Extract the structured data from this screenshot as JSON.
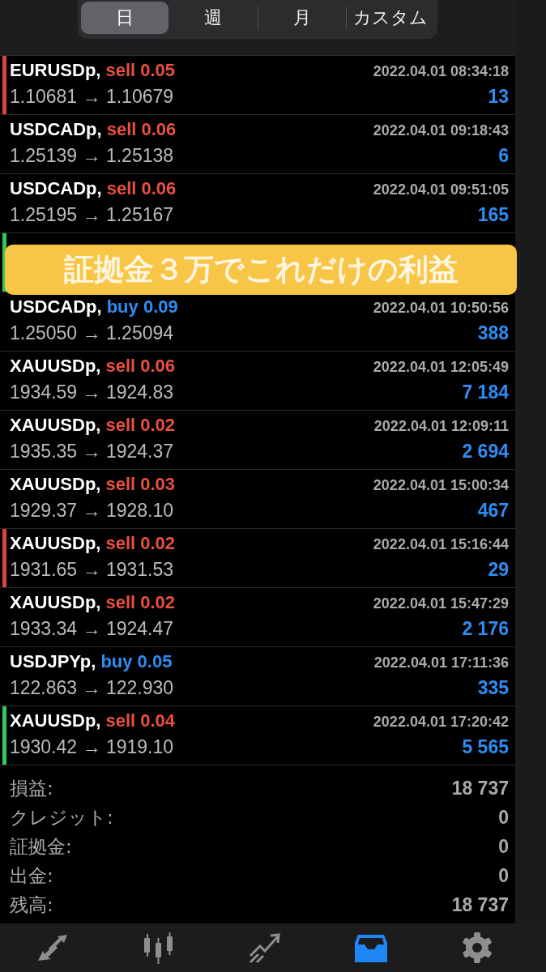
{
  "period_tabs": [
    {
      "label": "日",
      "selected": true
    },
    {
      "label": "週",
      "selected": false
    },
    {
      "label": "月",
      "selected": false
    },
    {
      "label": "カスタム",
      "selected": false
    }
  ],
  "deals": [
    {
      "symbol": "EURUSDp,",
      "kind": "sell",
      "order": "sell 0.05",
      "time": "2022.04.01 08:34:18",
      "prices": "1.10681 → 1.10679",
      "profit": "13",
      "color": "#d9453a"
    },
    {
      "symbol": "USDCADp,",
      "kind": "sell",
      "order": "sell 0.06",
      "time": "2022.04.01 09:18:43",
      "prices": "1.25139 → 1.25138",
      "profit": "6"
    },
    {
      "symbol": "USDCADp,",
      "kind": "sell",
      "order": "sell 0.06",
      "time": "2022.04.01 09:51:05",
      "prices": "1.25195 → 1.25167",
      "profit": "165"
    },
    {
      "kind": "hidden",
      "color": "#34c759"
    },
    {
      "symbol": "USDCADp,",
      "kind": "buy",
      "order": "buy 0.09",
      "time": "2022.04.01 10:50:56",
      "prices": "1.25050 → 1.25094",
      "profit": "388"
    },
    {
      "symbol": "XAUUSDp,",
      "kind": "sell",
      "order": "sell 0.06",
      "time": "2022.04.01 12:05:49",
      "prices": "1934.59 → 1924.83",
      "profit": "7 184"
    },
    {
      "symbol": "XAUUSDp,",
      "kind": "sell",
      "order": "sell 0.02",
      "time": "2022.04.01 12:09:11",
      "prices": "1935.35 → 1924.37",
      "profit": "2 694"
    },
    {
      "symbol": "XAUUSDp,",
      "kind": "sell",
      "order": "sell 0.03",
      "time": "2022.04.01 15:00:34",
      "prices": "1929.37 → 1928.10",
      "profit": "467"
    },
    {
      "symbol": "XAUUSDp,",
      "kind": "sell",
      "order": "sell 0.02",
      "time": "2022.04.01 15:16:44",
      "prices": "1931.65 → 1931.53",
      "profit": "29",
      "color": "#d9453a"
    },
    {
      "symbol": "XAUUSDp,",
      "kind": "sell",
      "order": "sell 0.02",
      "time": "2022.04.01 15:47:29",
      "prices": "1933.34 → 1924.47",
      "profit": "2 176"
    },
    {
      "symbol": "USDJPYp,",
      "kind": "buy",
      "order": "buy 0.05",
      "time": "2022.04.01 17:11:36",
      "prices": "122.863 → 122.930",
      "profit": "335"
    },
    {
      "symbol": "XAUUSDp,",
      "kind": "sell",
      "order": "sell 0.04",
      "time": "2022.04.01 17:20:42",
      "prices": "1930.42 → 1919.10",
      "profit": "5 565",
      "color": "#34c759"
    }
  ],
  "banner": "証拠金３万でこれだけの利益",
  "summary": [
    {
      "label": "損益:",
      "value": "18 737"
    },
    {
      "label": "クレジット:",
      "value": "0"
    },
    {
      "label": "証拠金:",
      "value": "0"
    },
    {
      "label": "出金:",
      "value": "0"
    },
    {
      "label": "残高:",
      "value": "18 737"
    }
  ],
  "tab_bar": [
    {
      "kind": "trade",
      "selected": false
    },
    {
      "kind": "chart",
      "selected": false
    },
    {
      "kind": "trend",
      "selected": false
    },
    {
      "kind": "inbox",
      "selected": true
    },
    {
      "kind": "settings",
      "selected": false
    }
  ]
}
